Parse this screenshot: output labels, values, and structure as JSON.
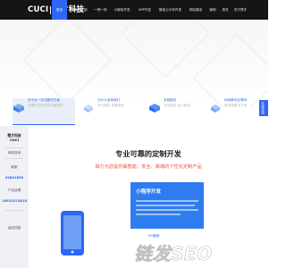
{
  "header": {
    "logo_left": "CUCI",
    "logo_right": "楚才科技",
    "nav": [
      {
        "label": "首页",
        "active": true
      },
      {
        "label": "微商城定制",
        "active": false
      },
      {
        "label": "一物一码",
        "active": false
      },
      {
        "label": "小程序开发",
        "active": false
      },
      {
        "label": "APP开发",
        "active": false
      },
      {
        "label": "微信公众号开发",
        "active": false
      },
      {
        "label": "网站建设",
        "active": false
      },
      {
        "label": "案例",
        "active": false
      },
      {
        "label": "资讯",
        "active": false
      },
      {
        "label": "关于楚才",
        "active": false
      }
    ]
  },
  "services": [
    {
      "title": "全平台一站式解决方案",
      "desc": "软硬件定制开发全面服务",
      "active": true
    },
    {
      "title": "为什么选择我们",
      "desc": "专业团队 深度服务",
      "active": false
    },
    {
      "title": "全程服务",
      "desc": "专业服务 贴心售后",
      "active": false
    },
    {
      "title": "玩转移动互联网",
      "desc": "新零售解决方案",
      "active": false
    }
  ],
  "float_tab": "在线咨询",
  "contact": {
    "logo_line1": "楚才科技",
    "logo_line2": "CUCI",
    "online": "网络咨询",
    "hotline_label": "客服",
    "phone1": "34841639",
    "product_label": "产品经理",
    "phone2": "18922374818",
    "back_top": "返回顶部"
  },
  "section": {
    "title": "专业可靠的定制开发",
    "subtitle": "竭力为您提供最智能、安全、高端的个性化定制产品"
  },
  "feature": {
    "title": "小程序开发"
  },
  "mini_card": "H5营销",
  "watermark": {
    "text": "链发SEO",
    "sub": "LIANFASEO.COM"
  },
  "colors": {
    "brand_blue": "#2d67f5",
    "header_bg": "#151515",
    "accent_red": "#e8553f"
  }
}
